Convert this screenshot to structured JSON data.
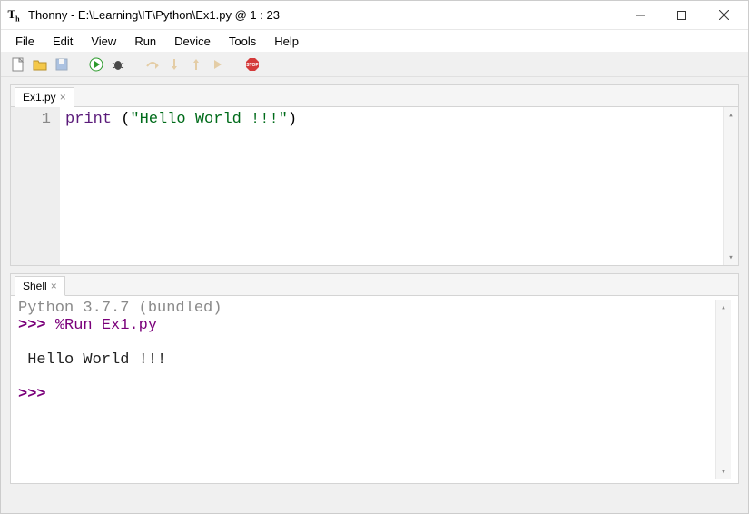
{
  "window": {
    "title": "Thonny  -  E:\\Learning\\IT\\Python\\Ex1.py  @  1 : 23"
  },
  "menubar": {
    "items": [
      "File",
      "Edit",
      "View",
      "Run",
      "Device",
      "Tools",
      "Help"
    ]
  },
  "toolbar": {
    "icons": [
      "new-file",
      "open-file",
      "save-file",
      "run",
      "debug",
      "step-over",
      "step-into",
      "step-out",
      "resume",
      "stop"
    ]
  },
  "editor": {
    "tab_label": "Ex1.py",
    "line_number": "1",
    "code": {
      "keyword": "print",
      "open": " (",
      "string": "\"Hello World !!!\"",
      "close": ")"
    }
  },
  "shell": {
    "tab_label": "Shell",
    "version_line": "Python 3.7.7 (bundled)",
    "prompt": ">>> ",
    "run_cmd": "%Run Ex1.py",
    "output": " Hello World !!!",
    "prompt2": ">>> "
  }
}
